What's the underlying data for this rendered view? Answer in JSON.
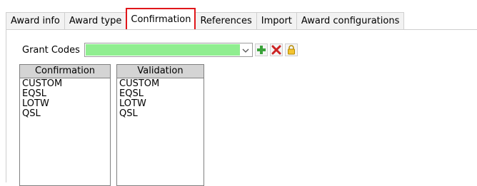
{
  "tabs": [
    {
      "label": "Award info",
      "active": false
    },
    {
      "label": "Award type",
      "active": false
    },
    {
      "label": "Confirmation",
      "active": true
    },
    {
      "label": "References",
      "active": false
    },
    {
      "label": "Import",
      "active": false
    },
    {
      "label": "Award configurations",
      "active": false
    }
  ],
  "grant_codes": {
    "label": "Grant Codes",
    "value": "",
    "fill_color": "#90ee90",
    "buttons": [
      {
        "name": "add-button",
        "icon": "plus-icon",
        "color": "#3aa23a"
      },
      {
        "name": "delete-button",
        "icon": "x-icon",
        "color": "#cc2222"
      },
      {
        "name": "lock-button",
        "icon": "lock-icon",
        "color": "#e0b000"
      }
    ]
  },
  "confirmation": {
    "header": "Confirmation",
    "items": [
      "CUSTOM",
      "EQSL",
      "LOTW",
      "QSL"
    ]
  },
  "validation": {
    "header": "Validation",
    "items": [
      "CUSTOM",
      "EQSL",
      "LOTW",
      "QSL"
    ]
  },
  "colors": {
    "active_tab_outline": "#e0161a",
    "grant_field": "#90ee90"
  }
}
